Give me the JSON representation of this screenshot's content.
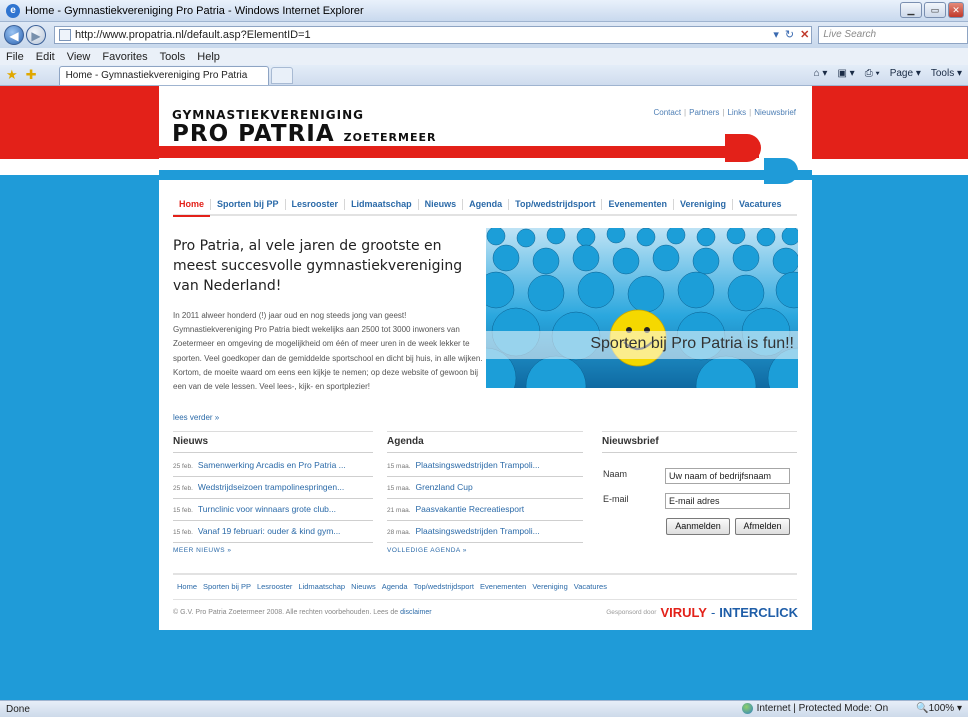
{
  "browser": {
    "window_title": "Home - Gymnastiekvereniging Pro Patria - Windows Internet Explorer",
    "url": "http://www.propatria.nl/default.asp?ElementID=1",
    "search_placeholder": "Live Search",
    "menu": [
      "File",
      "Edit",
      "View",
      "Favorites",
      "Tools",
      "Help"
    ],
    "tab_title": "Home - Gymnastiekvereniging Pro Patria",
    "command_bar": [
      "Page ▾",
      "Tools ▾"
    ],
    "status_left": "Done",
    "status_zone": "Internet | Protected Mode: On",
    "zoom": "100%"
  },
  "site": {
    "logo_top": "GYMNASTIEKVERENIGING",
    "logo_main": "PRO PATRIA",
    "logo_sub": "ZOETERMEER",
    "top_links": [
      "Contact",
      "Partners",
      "Links",
      "Nieuwsbrief"
    ],
    "nav": [
      "Home",
      "Sporten bij PP",
      "Lesrooster",
      "Lidmaatschap",
      "Nieuws",
      "Agenda",
      "Top/wedstrijdsport",
      "Evenementen",
      "Vereniging",
      "Vacatures"
    ],
    "intro_title": "Pro Patria, al vele jaren de grootste en meest succesvolle gymnastiekvereniging van Nederland!",
    "intro_text": "In 2011 alweer honderd (!) jaar oud en nog steeds jong van geest! Gymnastiekvereniging Pro Patria biedt wekelijks aan 2500 tot 3000 inwoners van Zoetermeer en omgeving de mogelijkheid om één of meer uren in de week lekker te sporten. Veel goedkoper dan de gemiddelde sportschool en dicht bij huis, in alle wijken. Kortom, de moeite waard om eens een kijkje te nemen; op deze website of gewoon bij een van de vele lessen. Veel lees-, kijk- en sportplezier!",
    "read_more": "lees verder »",
    "hero_caption": "Sporten bij Pro Patria is fun!!"
  },
  "news": {
    "heading": "Nieuws",
    "items": [
      {
        "date": "25 feb.",
        "title": "Samenwerking Arcadis en Pro Patria ..."
      },
      {
        "date": "25 feb.",
        "title": "Wedstrijdseizoen trampolinespringen..."
      },
      {
        "date": "15 feb.",
        "title": "Turnclinic voor winnaars grote club..."
      },
      {
        "date": "15 feb.",
        "title": "Vanaf 19 februari: ouder & kind gym..."
      }
    ],
    "more": "MEER NIEUWS »"
  },
  "agenda": {
    "heading": "Agenda",
    "items": [
      {
        "date": "15 maa.",
        "title": "Plaatsingswedstrijden Trampoli..."
      },
      {
        "date": "15 maa.",
        "title": "Grenzland Cup"
      },
      {
        "date": "21 maa.",
        "title": "Paasvakantie Recreatiesport"
      },
      {
        "date": "28 maa.",
        "title": "Plaatsingswedstrijden Trampoli..."
      }
    ],
    "more": "VOLLEDIGE AGENDA »"
  },
  "newsletter": {
    "heading": "Nieuwsbrief",
    "name_label": "Naam",
    "name_value": "Uw naam of bedrijfsnaam",
    "email_label": "E-mail",
    "email_value": "E-mail adres",
    "subscribe": "Aanmelden",
    "unsubscribe": "Afmelden"
  },
  "footer": {
    "nav": [
      "Home",
      "Sporten bij PP",
      "Lesrooster",
      "Lidmaatschap",
      "Nieuws",
      "Agenda",
      "Top/wedstrijdsport",
      "Evenementen",
      "Vereniging",
      "Vacatures"
    ],
    "copyright": "© G.V. Pro Patria Zoetermeer 2008. Alle rechten voorbehouden. Lees de",
    "disclaimer": "disclaimer",
    "sponsor_label": "Gesponsord door",
    "sponsor_1": "VIRULY",
    "sponsor_dash": "-",
    "sponsor_2": "INTERCLICK"
  },
  "colors": {
    "brand_red": "#e32119",
    "brand_blue": "#1f9bd8",
    "link_blue": "#2b6aa8"
  }
}
